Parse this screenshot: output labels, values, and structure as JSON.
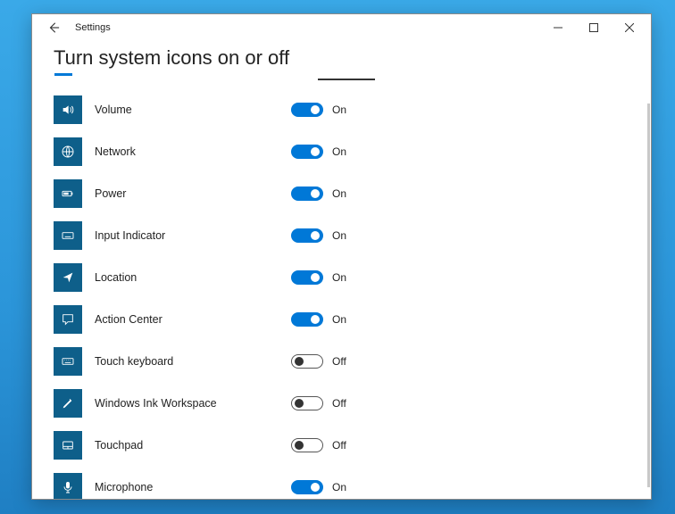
{
  "window": {
    "title": "Settings"
  },
  "page": {
    "heading": "Turn system icons on or off"
  },
  "labels": {
    "on": "On",
    "off": "Off"
  },
  "items": [
    {
      "id": "volume",
      "label": "Volume",
      "state": "on",
      "icon": "volume-icon"
    },
    {
      "id": "network",
      "label": "Network",
      "state": "on",
      "icon": "network-icon"
    },
    {
      "id": "power",
      "label": "Power",
      "state": "on",
      "icon": "power-icon"
    },
    {
      "id": "inputindicator",
      "label": "Input Indicator",
      "state": "on",
      "icon": "input-indicator-icon"
    },
    {
      "id": "location",
      "label": "Location",
      "state": "on",
      "icon": "location-icon"
    },
    {
      "id": "actioncenter",
      "label": "Action Center",
      "state": "on",
      "icon": "action-center-icon"
    },
    {
      "id": "touchkeyboard",
      "label": "Touch keyboard",
      "state": "off",
      "icon": "touch-keyboard-icon"
    },
    {
      "id": "ink",
      "label": "Windows Ink Workspace",
      "state": "off",
      "icon": "ink-icon"
    },
    {
      "id": "touchpad",
      "label": "Touchpad",
      "state": "off",
      "icon": "touchpad-icon"
    },
    {
      "id": "microphone",
      "label": "Microphone",
      "state": "on",
      "icon": "microphone-icon"
    }
  ]
}
